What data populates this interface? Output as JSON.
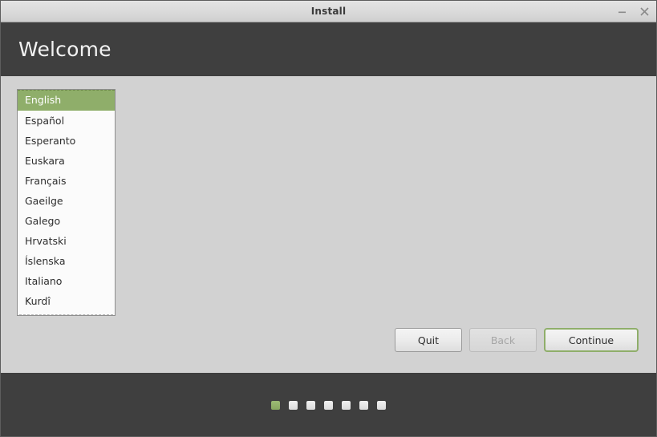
{
  "window": {
    "title": "Install",
    "minimize_icon": "minimize-icon",
    "close_icon": "close-icon"
  },
  "header": {
    "title": "Welcome"
  },
  "language_list": {
    "selected_index": 0,
    "items": [
      {
        "label": "English"
      },
      {
        "label": "Español"
      },
      {
        "label": "Esperanto"
      },
      {
        "label": "Euskara"
      },
      {
        "label": "Français"
      },
      {
        "label": "Gaeilge"
      },
      {
        "label": "Galego"
      },
      {
        "label": "Hrvatski"
      },
      {
        "label": "Íslenska"
      },
      {
        "label": "Italiano"
      },
      {
        "label": "Kurdî"
      }
    ]
  },
  "nav": {
    "quit_label": "Quit",
    "back_label": "Back",
    "continue_label": "Continue"
  },
  "footer": {
    "steps_total": 7,
    "current_step": 1
  },
  "colors": {
    "accent_green": "#8fae6a",
    "header_dark": "#3f3f3f",
    "content_bg": "#d2d2d2",
    "list_bg": "#fbfbfb"
  }
}
